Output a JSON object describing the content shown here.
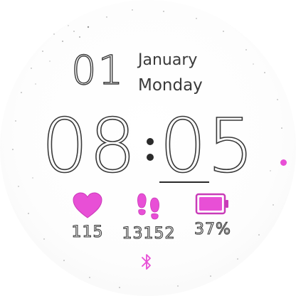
{
  "date": {
    "day": "01",
    "month": "January",
    "weekday": "Monday"
  },
  "time": {
    "hours": "08",
    "minutes": "05"
  },
  "stats": {
    "heart_rate": "115",
    "steps": "13152",
    "battery": "37%"
  },
  "battery_level": 0.37,
  "colors": {
    "accent": "#e84fd6",
    "text_stroke": "#3a3a3a",
    "background": "#ffffff"
  },
  "icons": {
    "heart": "heart-icon",
    "steps": "footprints-icon",
    "battery": "battery-icon",
    "bluetooth": "bluetooth-icon"
  }
}
